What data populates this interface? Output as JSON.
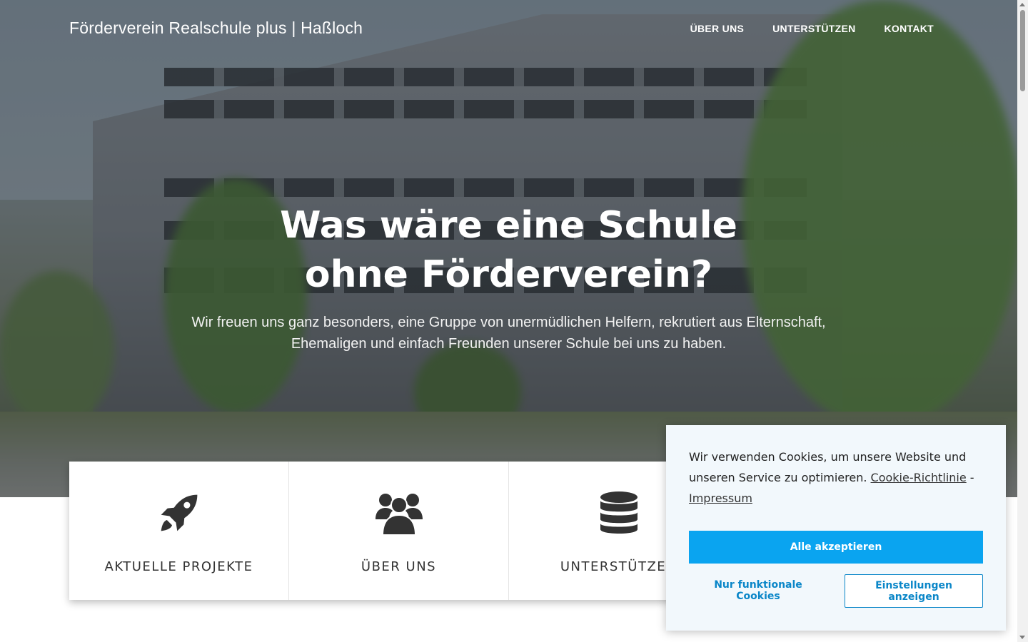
{
  "nav": {
    "brand": "Förderverein Realschule plus | Haßloch",
    "links": [
      "ÜBER UNS",
      "UNTERSTÜTZEN",
      "KONTAKT"
    ]
  },
  "hero": {
    "headline_line1": "Was wäre eine Schule",
    "headline_line2": "ohne Förderverein?",
    "subtext_line1": "Wir freuen uns ganz besonders, eine Gruppe von unermüdlichen Helfern, rekrutiert aus Elternschaft,",
    "subtext_line2": "Ehemaligen und einfach Freunden unserer Schule bei uns zu haben."
  },
  "features": [
    {
      "label": "AKTUELLE PROJEKTE",
      "icon": "rocket-icon"
    },
    {
      "label": "ÜBER UNS",
      "icon": "users-icon"
    },
    {
      "label": "UNTERSTÜTZEN",
      "icon": "database-icon"
    },
    {
      "label": "",
      "icon": ""
    }
  ],
  "cookie": {
    "message": "Wir verwenden Cookies, um unsere Website und unseren Service zu optimieren.",
    "policy_link": "Cookie-Richtlinie",
    "separator": "-",
    "imprint_link": "Impressum",
    "accept_label": "Alle akzeptieren",
    "functional_label": "Nur funktionale Cookies",
    "settings_label": "Einstellungen anzeigen"
  },
  "colors": {
    "accent": "#0aa4f0",
    "accent_dark": "#0a86c8",
    "cookie_bg": "#f2f8fc"
  }
}
